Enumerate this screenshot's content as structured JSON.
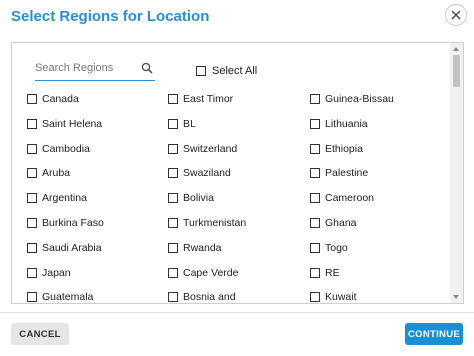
{
  "dialog": {
    "title": "Select Regions for Location",
    "close_icon": "close-icon"
  },
  "search": {
    "placeholder": "Search Regions",
    "value": "",
    "icon": "search-icon"
  },
  "select_all": {
    "label": "Select All",
    "checked": false
  },
  "regions": [
    [
      "Canada",
      "East Timor",
      "Guinea-Bissau"
    ],
    [
      "Saint Helena",
      "BL",
      "Lithuania"
    ],
    [
      "Cambodia",
      "Switzerland",
      "Ethiopia"
    ],
    [
      "Aruba",
      "Swaziland",
      "Palestine"
    ],
    [
      "Argentina",
      "Bolivia",
      "Cameroon"
    ],
    [
      "Burkina Faso",
      "Turkmenistan",
      "Ghana"
    ],
    [
      "Saudi Arabia",
      "Rwanda",
      "Togo"
    ],
    [
      "Japan",
      "Cape Verde",
      "RE"
    ],
    [
      "Guatemala",
      "Bosnia and",
      "Kuwait"
    ]
  ],
  "footer": {
    "cancel_label": "CANCEL",
    "continue_label": "CONTINUE"
  },
  "colors": {
    "accent": "#2a8fd1",
    "continue_button": "#1a8fd6",
    "cancel_button": "#e6e6e6"
  }
}
